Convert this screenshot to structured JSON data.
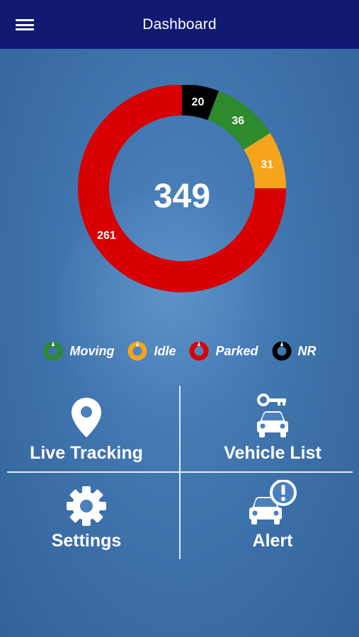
{
  "header": {
    "title": "Dashboard",
    "menu_icon": "hamburger-menu-icon"
  },
  "summary": {
    "total": "349"
  },
  "chart_data": {
    "type": "pie",
    "categories": [
      "NR",
      "Moving",
      "Idle",
      "Parked"
    ],
    "values": [
      20,
      36,
      31,
      261
    ],
    "colors": [
      "#000000",
      "#2d8a2d",
      "#f4a51c",
      "#d80000"
    ],
    "center_label": "349",
    "legend_placement": "bottom"
  },
  "legend": [
    {
      "label": "Moving",
      "color": "#2d8a2d"
    },
    {
      "label": "Idle",
      "color": "#f4a51c"
    },
    {
      "label": "Parked",
      "color": "#d80000"
    },
    {
      "label": "NR",
      "color": "#000000"
    }
  ],
  "tiles": {
    "live_tracking": {
      "label": "Live Tracking",
      "icon": "map-pin-icon"
    },
    "vehicle_list": {
      "label": "Vehicle List",
      "icon": "car-key-icon"
    },
    "settings": {
      "label": "Settings",
      "icon": "gear-icon"
    },
    "alert": {
      "label": "Alert",
      "icon": "car-alert-icon"
    }
  }
}
